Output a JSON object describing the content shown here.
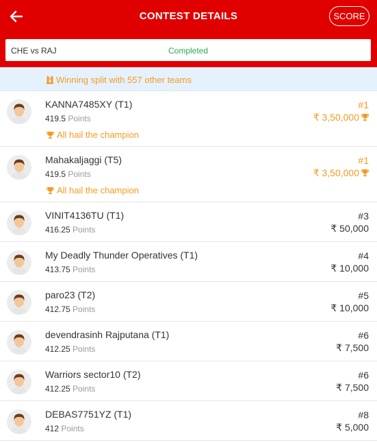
{
  "header": {
    "title": "CONTEST DETAILS",
    "score_label": "SCORE",
    "accent_color": "#e00000"
  },
  "match": {
    "name": "CHE vs RAJ",
    "status": "Completed"
  },
  "split_banner": {
    "text": "Winning split with 557 other teams"
  },
  "points_label": "Points",
  "leaderboard": [
    {
      "name": "KANNA7485XY (T1)",
      "points": "419.5",
      "rank": "#1",
      "prize": "₹ 3,50,000",
      "winner": true,
      "note": "All hail the champion"
    },
    {
      "name": "Mahakaljaggi (T5)",
      "points": "419.5",
      "rank": "#1",
      "prize": "₹ 3,50,000",
      "winner": true,
      "note": "All hail the champion"
    },
    {
      "name": "VINIT4136TU (T1)",
      "points": "416.25",
      "rank": "#3",
      "prize": "₹ 50,000",
      "winner": false
    },
    {
      "name": "My Deadly Thunder Operatives (T1)",
      "points": "413.75",
      "rank": "#4",
      "prize": "₹ 10,000",
      "winner": false
    },
    {
      "name": "paro23 (T2)",
      "points": "412.75",
      "rank": "#5",
      "prize": "₹ 10,000",
      "winner": false
    },
    {
      "name": "devendrasinh Rajputana (T1)",
      "points": "412.25",
      "rank": "#6",
      "prize": "₹ 7,500",
      "winner": false
    },
    {
      "name": "Warriors sector10 (T2)",
      "points": "412.25",
      "rank": "#6",
      "prize": "₹ 7,500",
      "winner": false
    },
    {
      "name": "DEBAS7751YZ (T1)",
      "points": "412",
      "rank": "#8",
      "prize": "₹ 5,000",
      "winner": false
    }
  ]
}
